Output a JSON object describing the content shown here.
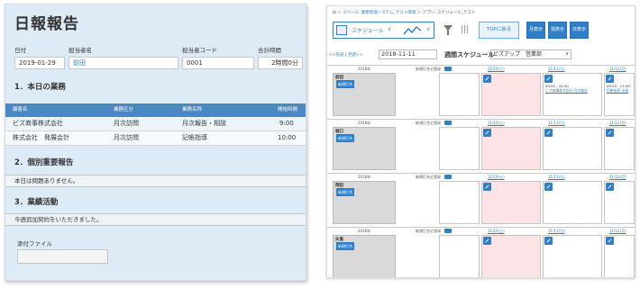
{
  "report": {
    "title": "日報報告",
    "fields": {
      "date_label": "日付",
      "date_value": "2019-01-29",
      "person_label": "担当者名",
      "person_value": "前田",
      "code_label": "担当者コード",
      "code_value": "0001",
      "hours_label": "合計時間",
      "hours_value": "2時間0分"
    },
    "section1": "1．本日の業務",
    "table": {
      "headers": [
        "顧客名",
        "業務区分",
        "業務名称",
        "開始時間"
      ],
      "rows": [
        [
          "ビズ商事株式会社",
          "月次訪問",
          "月次報告・相談",
          "9:00"
        ],
        [
          "株式会社　発展会計",
          "月次訪問",
          "記帳指導",
          "10:00"
        ]
      ]
    },
    "section2": "2．個別重要報告",
    "section2_text": "本日は問題ありません。",
    "section3": "3．業績活動",
    "section3_text": "今週追加契約をいただきました。",
    "attachment_label": "添付ファイル"
  },
  "schedule": {
    "breadcrumb": {
      "home": "⌂",
      "path1": "スペース: 業務管理システム_テスト環境",
      "sep": "＞",
      "path2": "アプリ: スケジュール_テスト"
    },
    "toolbar": {
      "view_label": "スケジュール",
      "dropdown": "∨",
      "top_button": "TOPに戻る",
      "views": [
        "月表示",
        "週表示",
        "日表示"
      ]
    },
    "nav": {
      "prev_week": "<<先週",
      "today_sep": " | ",
      "next_week": "翌週>>",
      "date": "2018-11-11",
      "week_title": "週間スケジュール",
      "group": "ビズアップ　営業部"
    },
    "week_header": {
      "year": "2018年",
      "group_label": "新規打合せ登録",
      "days": [
        "11/10(土)",
        "11/11(日)",
        "11/12(月)",
        "11/13(火)"
      ]
    },
    "users": [
      {
        "name": "前田",
        "button": "新規打合",
        "events": {
          "d3": [
            "09:00 - 10:00",
            "ビズ商事株式会社 月次報告"
          ],
          "d4": [
            "09:00 - 17:00",
            "記帳指導 出張"
          ]
        }
      },
      {
        "name": "堀口",
        "button": "新規打合",
        "events": {}
      },
      {
        "name": "岡田",
        "button": "新規打合",
        "events": {}
      },
      {
        "name": "矢島",
        "button": "新規打合",
        "events": {}
      }
    ],
    "colors": {
      "accent": "#2e7fc6",
      "weekend": "#fce4e6"
    }
  }
}
